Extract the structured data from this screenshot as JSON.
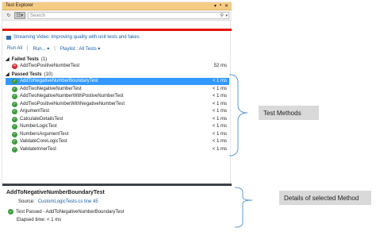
{
  "window": {
    "title": "Test Explorer",
    "controls": [
      "▾",
      "▪",
      "✕"
    ]
  },
  "toolbar": {
    "refresh_icon": "↻",
    "group_icon": "☷▾",
    "search_placeholder": "Search",
    "search_icon": "⚲",
    "search_dropdown": "▾"
  },
  "promo": {
    "text": "Streaming Video: Improving quality with unit tests and fakes"
  },
  "actions": {
    "run_all": "Run All",
    "run": "Run... ▾",
    "playlist": "Playlist : All Tests ▾",
    "separator": "|"
  },
  "failed": {
    "label": "Failed Tests",
    "count": "(1)",
    "tests": [
      {
        "name": "AddTwoPositiveNumberTest",
        "duration": "52 ms"
      }
    ]
  },
  "passed": {
    "label": "Passed Tests",
    "count": "(10)",
    "tests": [
      {
        "name": "AddToNegativeNumberBoundaryTest",
        "duration": "< 1 ms",
        "selected": true
      },
      {
        "name": "AddTwoNegativeNumberTest",
        "duration": "< 1 ms"
      },
      {
        "name": "AddTwoNegativeNumberWithPostiveNumberTest",
        "duration": "< 1 ms"
      },
      {
        "name": "AddTwoPositiveNumberWithNegativeNumberTest",
        "duration": "< 1 ms"
      },
      {
        "name": "ArgumentTest",
        "duration": "< 1 ms"
      },
      {
        "name": "CalculateDetailsTest",
        "duration": "< 1 ms"
      },
      {
        "name": "NumberLogicTest",
        "duration": "< 1 ms"
      },
      {
        "name": "NumbersArgumentTest",
        "duration": "< 1 ms"
      },
      {
        "name": "ValidateCoreLogicTest",
        "duration": "< 1 ms"
      },
      {
        "name": "ValidateInnerTest",
        "duration": "< 1 ms"
      }
    ]
  },
  "details": {
    "title": "AddToNegativeNumberBoundaryTest",
    "source_label": "Source:",
    "source_link": "CustomLogicTests.cs line 45",
    "status": "Test Passed - AddToNegativeNumberBoundaryTest",
    "elapsed": "Elapsed time: < 1 ms"
  },
  "callouts": {
    "methods": "Test Methods",
    "details": "Details of selected Method"
  },
  "colors": {
    "accent_titlebar": "#f5cc84",
    "red_bar": "#e51400",
    "selected_row": "#3399ff",
    "pass": "#3e9b3e",
    "fail": "#d42c2c",
    "link": "#1a5ea8"
  }
}
